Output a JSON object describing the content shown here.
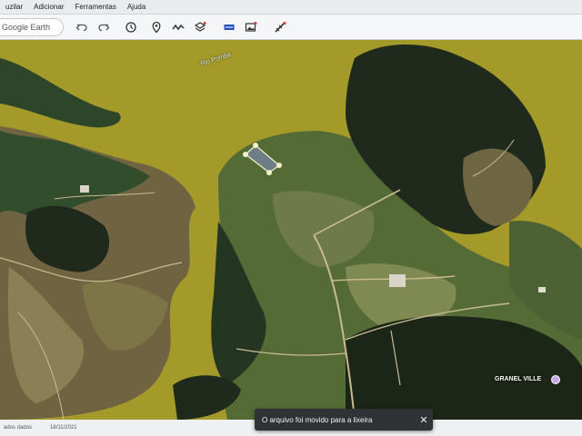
{
  "menu": {
    "items": [
      "uzilar",
      "Adicionar",
      "Ferramentas",
      "Ajuda"
    ]
  },
  "toolbar": {
    "search_text": "Google Earth",
    "buttons": [
      "undo-icon",
      "redo-icon",
      "history-icon",
      "placemark-icon",
      "path-icon",
      "layers-icon",
      "photo-overlay-icon",
      "image-icon",
      "measure-icon"
    ]
  },
  "map": {
    "river_label": "Rio Pomba",
    "pin_label": "GRANEL VILLE",
    "pin_color": "#c9a7e8"
  },
  "status": {
    "imagery_label": "ados dados",
    "imagery_date": "18/11/2021"
  },
  "toast": {
    "message": "O arquivo foi movido para a lixeira",
    "close": "✕"
  },
  "colors": {
    "water": "#a39a2a",
    "forest": "#1f2a1c",
    "field": "#8a7d52"
  }
}
